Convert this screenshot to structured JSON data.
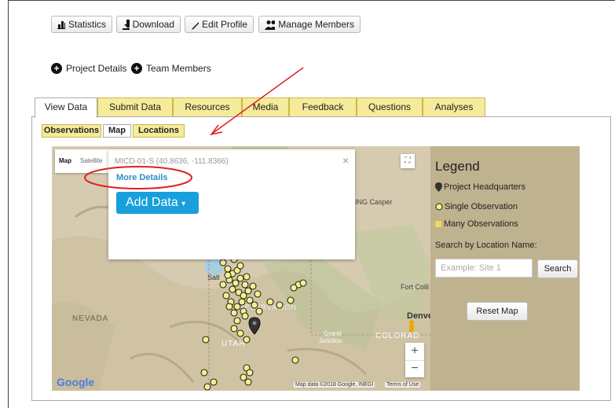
{
  "toolbar": {
    "statistics": "Statistics",
    "download": "Download",
    "edit_profile": "Edit Profile",
    "manage_members": "Manage Members"
  },
  "sublinks": {
    "project_details": "Project Details",
    "team_members": "Team Members"
  },
  "tabs": [
    "View Data",
    "Submit Data",
    "Resources",
    "Media",
    "Feedback",
    "Questions",
    "Analyses"
  ],
  "active_tab": "View Data",
  "subtabs": [
    "Observations",
    "Map",
    "Locations"
  ],
  "active_subtab": "Map",
  "map": {
    "type_map": "Map",
    "type_satellite": "Satellite",
    "popup_title": "MICD-01-S (40.8636, -111.8366)",
    "more_details": "More Details",
    "add_data": "Add Data",
    "close": "×",
    "labels": {
      "nevada": "NEVADA",
      "utah": "UTAH",
      "colorado": "COLORAD",
      "denver": "Denve",
      "casper": "ING Casper",
      "salt": "Salt",
      "fort_collins": "Fort Colli",
      "reservation": "RESERVATION",
      "grand_junction_1": "Grand",
      "grand_junction_2": "Junction",
      "google": "Google",
      "attribution": "Map data ©2018 Google, INEGI",
      "terms": "Terms of Use"
    }
  },
  "legend": {
    "title": "Legend",
    "headquarters": "Project Headquarters",
    "single": "Single Observation",
    "many": "Many Observations",
    "search_label": "Search by Location Name:",
    "search_placeholder": "Example: Site 1",
    "search_button": "Search",
    "reset_button": "Reset Map"
  },
  "colors": {
    "tab_bg": "#f5eb9b",
    "legend_bg": "#bfb28e",
    "add_data": "#18a0dc",
    "marker_fill": "#f3f08c",
    "annotation_red": "#e02020"
  }
}
